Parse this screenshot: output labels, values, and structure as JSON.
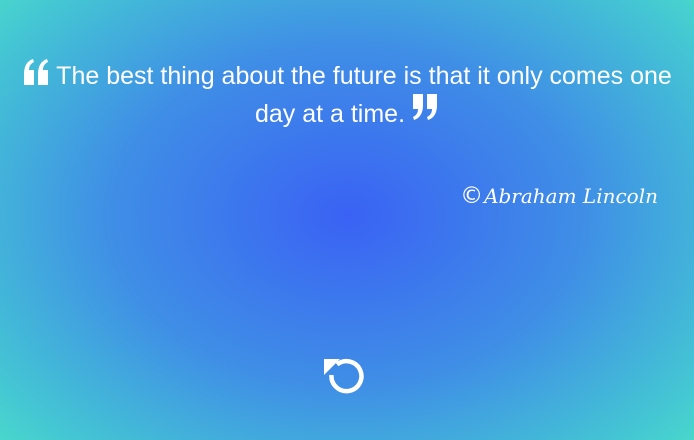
{
  "quote": {
    "text": "The best thing about the future is that it only comes one day at a time.",
    "open_icon": "open-quote-icon",
    "close_icon": "close-quote-icon"
  },
  "author": {
    "symbol": "©",
    "name": "Abraham Lincoln"
  },
  "controls": {
    "refresh_icon": "refresh-icon"
  },
  "colors": {
    "center": "#3a62f4",
    "edge": "#4ee8c4",
    "text": "#ffffff"
  }
}
